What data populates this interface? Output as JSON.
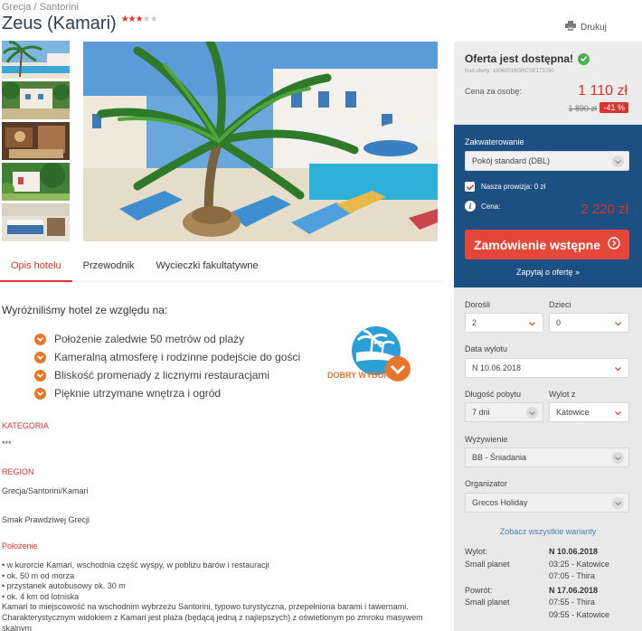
{
  "breadcrumb": "Grecja / Santorini",
  "hotel": {
    "title": "Zeus (Kamari)",
    "stars_on": "★★★",
    "stars_off": "★★"
  },
  "print_label": "Drukuj",
  "tabs": [
    {
      "label": "Opis hotelu"
    },
    {
      "label": "Przewodnik"
    },
    {
      "label": "Wycieczki fakultatywne"
    }
  ],
  "why": {
    "heading": "Wyróżniliśmy hotel ze względu na:",
    "items": [
      "Położenie zaledwie 50 metrów od plaży",
      "Kameralną atmosferę i rodzinne podejście do gości",
      "Bliskość promenady z licznymi restauracjami",
      "Pięknie utrzymane wnętrza i ogród"
    ],
    "badge": "DOBRY WYBÓR"
  },
  "sections": {
    "kategoria_label": "KATEGORIA",
    "kategoria_value": "***",
    "region_label": "REGION",
    "region_value": "Grecja/Santorini/Kamari",
    "smak": "Smak Prawdziwej Grecji",
    "polozenie_label": "Położenie",
    "polozenie_lines": [
      "• w kurorcie Kamari, wschodnia część wyspy, w pobliżu barów i restauracji",
      "• ok. 50 m od morza",
      "• przystanek autobusowy ok. 30 m",
      "• ok. 4 km od lotniska",
      "Kamari to miejscowość na wschodnim wybrzeżu Santorini, typowo turystyczna, przepełniona barami i tawernami.",
      "Charakterystycznym widokiem z Kamari jest plaża (będącą jedną z najlepszych) z oświetlonym po zmroku masywem skalnym"
    ]
  },
  "offer": {
    "available": "Oferta jest dostępna!",
    "code": "Kod oferty: 10062018GRCSE173780",
    "per_person_label": "Cena za osobę:",
    "price": "1 110 zł",
    "old_price": "1 890 zł",
    "discount": "-41 %"
  },
  "booking": {
    "accommodation_label": "Zakwaterowanie",
    "room": "Pokój standard (DBL)",
    "commission": "Nasza prowizja: 0 zł",
    "price_label": "Cena:",
    "total_price": "2 220 zł",
    "order_button": "Zamówienie wstępne",
    "ask_link": "Zapytaj o ofertę »"
  },
  "filters": {
    "adults_label": "Dorośli",
    "adults": "2",
    "children_label": "Dzieci",
    "children": "0",
    "date_label": "Data wylotu",
    "date": "N 10.06.2018",
    "length_label": "Długość pobytu",
    "length": "7 dni",
    "from_label": "Wylot z",
    "from": "Katowice",
    "board_label": "Wyżywienie",
    "board": "BB - Śniadania",
    "organizer_label": "Organizator",
    "organizer": "Grecos Holiday",
    "see_all": "Zobacz wszystkie warianty"
  },
  "flights": {
    "out_label": "Wylot:",
    "out_date": "N 10.06.2018",
    "out_carrier": "Small planet",
    "out_dep": "03:25 - Katowice",
    "out_arr": "07:05 - Thira",
    "ret_label": "Powrót:",
    "ret_date": "N 17.06.2018",
    "ret_carrier": "Small planet",
    "ret_dep": "07:55 - Thira",
    "ret_arr": "09:55 - Katowice"
  },
  "colors": {
    "accent_red": "#d9342b",
    "booking_blue": "#1c4f82",
    "check_orange": "#e8762c",
    "ok_green": "#4caf50"
  }
}
